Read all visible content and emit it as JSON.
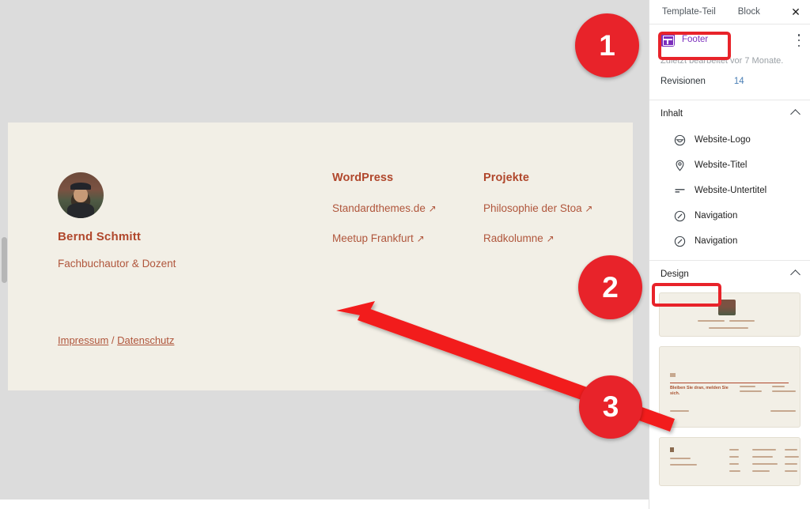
{
  "sidebar": {
    "tabs": [
      {
        "label": "Template-Teil"
      },
      {
        "label": "Block"
      }
    ],
    "close_label": "✕",
    "template_part": {
      "name": "Footer",
      "icon": "template-part-icon",
      "menu_icon": "more-options-icon"
    },
    "last_edited": "Zuletzt bearbeitet vor 7 Monate.",
    "revisions": {
      "label": "Revisionen",
      "count": "14"
    },
    "sections": [
      {
        "label": "Inhalt",
        "state": "expanded"
      },
      {
        "label": "Design",
        "state": "expanded"
      }
    ],
    "content_items": [
      {
        "label": "Website-Logo",
        "icon": "site-logo-icon"
      },
      {
        "label": "Website-Titel",
        "icon": "map-pin-icon"
      },
      {
        "label": "Website-Untertitel",
        "icon": "tagline-icon"
      },
      {
        "label": "Navigation",
        "icon": "navigation-icon"
      },
      {
        "label": "Navigation",
        "icon": "navigation-icon"
      }
    ],
    "patterns": [
      {
        "name": "pattern-preview-1"
      },
      {
        "name": "pattern-preview-2",
        "heading": "Bleiben Sie dran, melden Sie sich."
      },
      {
        "name": "pattern-preview-3"
      }
    ]
  },
  "canvas": {
    "footer": {
      "profile": {
        "name": "Bernd Schmitt",
        "role": "Fachbuchautor & Dozent",
        "avatar_alt": "avatar"
      },
      "legal": {
        "imprint": "Impressum",
        "separator": " / ",
        "privacy": "Datenschutz"
      },
      "columns": [
        {
          "title": "WordPress",
          "links": [
            {
              "label": "Standardthemes.de",
              "external": "↗"
            },
            {
              "label": "Meetup Frankfurt",
              "external": "↗"
            }
          ]
        },
        {
          "title": "Projekte",
          "links": [
            {
              "label": "Philosophie der Stoa",
              "external": "↗"
            },
            {
              "label": "Radkolumne",
              "external": "↗"
            }
          ]
        }
      ]
    }
  },
  "annotations": {
    "badges": [
      {
        "number": "1"
      },
      {
        "number": "2"
      },
      {
        "number": "3"
      }
    ],
    "color": "#e8232a"
  },
  "colors": {
    "accent_red": "#e8232a",
    "footer_bg": "#f2efe6",
    "footer_text": "#b0563c",
    "footer_heading": "#b0472c",
    "template_part_purple": "#7b2ebd",
    "link_blue": "#4a7fb5",
    "canvas_bg": "#dcdcdc"
  }
}
